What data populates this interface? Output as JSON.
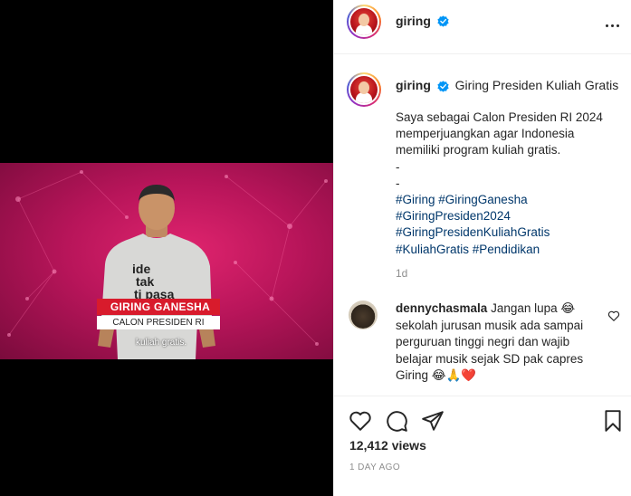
{
  "post": {
    "username": "giring",
    "header_more_icon": "more-horizontal-icon",
    "verified_icon": "verified-badge-icon"
  },
  "video": {
    "shirt_text": "ide tak ti pasa",
    "lower_third_name": "GIRING GANESHA",
    "lower_third_title": "CALON PRESIDEN RI",
    "subtitle": "kuliah gratis."
  },
  "caption": {
    "username": "giring",
    "title": "Giring Presiden Kuliah Gratis",
    "body": "Saya sebagai Calon Presiden RI 2024 memperjuangkan agar Indonesia memiliki program kuliah gratis.",
    "dash1": "-",
    "dash2": "-",
    "hashtags": [
      "#Giring #GiringGanesha",
      "#GiringPresiden2024",
      "#GiringPresidenKuliahGratis",
      "#KuliahGratis #Pendidikan"
    ],
    "age": "1d"
  },
  "comment": {
    "username": "dennychasmala",
    "text": "Jangan lupa 😂 sekolah jurusan musik ada sampai perguruan tinggi negri dan wajib belajar musik sejak SD pak capres Giring 😂🙏❤️"
  },
  "stats": {
    "views_count": "12,412",
    "views_label": "views",
    "date": "1 DAY AGO"
  },
  "colors": {
    "hashtag": "#00376b",
    "verified": "#0095f6",
    "muted": "#8e8e8e",
    "lower_third_red": "#d81b2c",
    "video_magenta": "#c2185b"
  }
}
